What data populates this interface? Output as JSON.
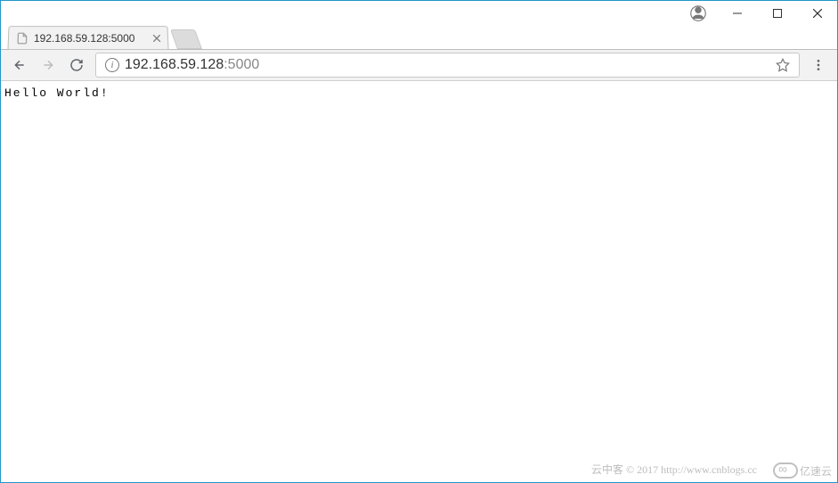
{
  "window": {
    "account_tooltip": "Account"
  },
  "tab": {
    "title": "192.168.59.128:5000"
  },
  "toolbar": {
    "url_display": "192.168.59.128:5000",
    "url_main": "192.168.59.128",
    "url_port": ":5000"
  },
  "page": {
    "body_text": "Hello World!"
  },
  "watermark": {
    "text": "云中客 © 2017 http://www.cnblogs.cc",
    "logo_text": "亿速云"
  }
}
